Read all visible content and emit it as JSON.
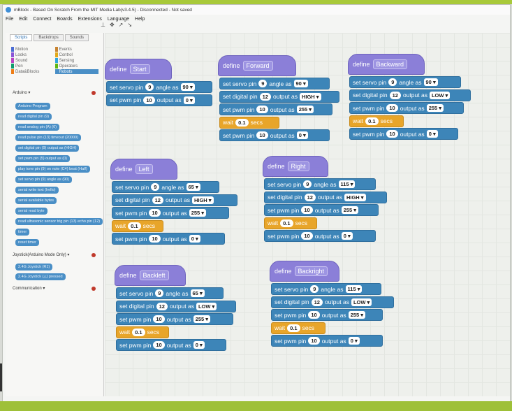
{
  "window": {
    "title": "mBlock - Based On Scratch From the MIT Media Lab(v3.4.5) - Disconnected - Not saved"
  },
  "menu": [
    "File",
    "Edit",
    "Connect",
    "Boards",
    "Extensions",
    "Language",
    "Help"
  ],
  "palette": {
    "tabs": [
      "Scripts",
      "Backdrops",
      "Sounds"
    ],
    "categories": [
      {
        "label": "Motion",
        "color": "#4a6cd4"
      },
      {
        "label": "Events",
        "color": "#c88330"
      },
      {
        "label": "Looks",
        "color": "#8a55d7"
      },
      {
        "label": "Control",
        "color": "#e1a91a"
      },
      {
        "label": "Sound",
        "color": "#bb42c3"
      },
      {
        "label": "Sensing",
        "color": "#2ca5e2"
      },
      {
        "label": "Pen",
        "color": "#0e9a6c"
      },
      {
        "label": "Operators",
        "color": "#5cb712"
      },
      {
        "label": "Data&Blocks",
        "color": "#ee7d16"
      },
      {
        "label": "Robots",
        "color": "#4a8fc6"
      }
    ],
    "section_arduino": "Arduino ▾",
    "blocks": [
      "Arduino Program",
      "read digital pin (9)",
      "read analog pin (A) (0)",
      "read pulse pin (13) timeout (20000)",
      "set digital pin (9) output as (HIGH)",
      "set pwm pin (5) output as (0)",
      "play tone pin (9) on note (C4) beat (Half)",
      "set servo pin (9) angle as (90)",
      "serial write text (hello)",
      "serial available bytes",
      "serial read byte",
      "read ultrasonic sensor trig pin (13) echo pin (12)",
      "timer",
      "reset timer"
    ],
    "section_joystick": "Joystick(Arduino Mode Only) ▾",
    "joystick_blocks": [
      "2.4G Joystick (R1)",
      "2.4G Joystick (△) pressed"
    ],
    "section_comm": "Communication ▾"
  },
  "scripts": [
    {
      "name": "Start",
      "rows": [
        {
          "type": "servo",
          "text": "set servo pin",
          "pin": "9",
          "mid": "angle as",
          "val": "90"
        },
        {
          "type": "pwm",
          "text": "set pwm pin",
          "pin": "10",
          "mid": "output as",
          "val": "0"
        }
      ]
    },
    {
      "name": "Forward",
      "rows": [
        {
          "type": "servo",
          "text": "set servo pin",
          "pin": "9",
          "mid": "angle as",
          "val": "90"
        },
        {
          "type": "digital",
          "text": "set digital pin",
          "pin": "12",
          "mid": "output as",
          "val": "HIGH"
        },
        {
          "type": "pwm",
          "text": "set pwm pin",
          "pin": "10",
          "mid": "output as",
          "val": "255"
        },
        {
          "type": "wait",
          "text": "wait",
          "pin": "0.1",
          "mid": "secs",
          "val": ""
        },
        {
          "type": "pwm",
          "text": "set pwm pin",
          "pin": "10",
          "mid": "output as",
          "val": "0"
        }
      ]
    },
    {
      "name": "Backward",
      "rows": [
        {
          "type": "servo",
          "text": "set servo pin",
          "pin": "9",
          "mid": "angle as",
          "val": "90"
        },
        {
          "type": "digital",
          "text": "set digital pin",
          "pin": "12",
          "mid": "output as",
          "val": "LOW"
        },
        {
          "type": "pwm",
          "text": "set pwm pin",
          "pin": "10",
          "mid": "output as",
          "val": "255"
        },
        {
          "type": "wait",
          "text": "wait",
          "pin": "0.1",
          "mid": "secs",
          "val": ""
        },
        {
          "type": "pwm",
          "text": "set pwm pin",
          "pin": "10",
          "mid": "output as",
          "val": "0"
        }
      ]
    },
    {
      "name": "Left",
      "rows": [
        {
          "type": "servo",
          "text": "set servo pin",
          "pin": "9",
          "mid": "angle as",
          "val": "65"
        },
        {
          "type": "digital",
          "text": "set digital pin",
          "pin": "12",
          "mid": "output as",
          "val": "HIGH"
        },
        {
          "type": "pwm",
          "text": "set pwm pin",
          "pin": "10",
          "mid": "output as",
          "val": "255"
        },
        {
          "type": "wait",
          "text": "wait",
          "pin": "0.1",
          "mid": "secs",
          "val": ""
        },
        {
          "type": "pwm",
          "text": "set pwm pin",
          "pin": "10",
          "mid": "output as",
          "val": "0"
        }
      ]
    },
    {
      "name": "Right",
      "rows": [
        {
          "type": "servo",
          "text": "set servo pin",
          "pin": "9",
          "mid": "angle as",
          "val": "115"
        },
        {
          "type": "digital",
          "text": "set digital pin",
          "pin": "12",
          "mid": "output as",
          "val": "HIGH"
        },
        {
          "type": "pwm",
          "text": "set pwm pin",
          "pin": "10",
          "mid": "output as",
          "val": "255"
        },
        {
          "type": "wait",
          "text": "wait",
          "pin": "0.1",
          "mid": "secs",
          "val": ""
        },
        {
          "type": "pwm",
          "text": "set pwm pin",
          "pin": "10",
          "mid": "output as",
          "val": "0"
        }
      ]
    },
    {
      "name": "Backleft",
      "rows": [
        {
          "type": "servo",
          "text": "set servo pin",
          "pin": "9",
          "mid": "angle as",
          "val": "65"
        },
        {
          "type": "digital",
          "text": "set digital pin",
          "pin": "12",
          "mid": "output as",
          "val": "LOW"
        },
        {
          "type": "pwm",
          "text": "set pwm pin",
          "pin": "10",
          "mid": "output as",
          "val": "255"
        },
        {
          "type": "wait",
          "text": "wait",
          "pin": "0.1",
          "mid": "secs",
          "val": ""
        },
        {
          "type": "pwm",
          "text": "set pwm pin",
          "pin": "10",
          "mid": "output as",
          "val": "0"
        }
      ]
    },
    {
      "name": "Backright",
      "rows": [
        {
          "type": "servo",
          "text": "set servo pin",
          "pin": "9",
          "mid": "angle as",
          "val": "115"
        },
        {
          "type": "digital",
          "text": "set digital pin",
          "pin": "12",
          "mid": "output as",
          "val": "LOW"
        },
        {
          "type": "pwm",
          "text": "set pwm pin",
          "pin": "10",
          "mid": "output as",
          "val": "255"
        },
        {
          "type": "wait",
          "text": "wait",
          "pin": "0.1",
          "mid": "secs",
          "val": ""
        },
        {
          "type": "pwm",
          "text": "set pwm pin",
          "pin": "10",
          "mid": "output as",
          "val": "0"
        }
      ]
    }
  ],
  "define_label": "define",
  "colors": {
    "hat": "#8b7fd8",
    "robot_block": "#3d85b8",
    "wait_block": "#e8a52a",
    "accent": "#a8c93a"
  }
}
